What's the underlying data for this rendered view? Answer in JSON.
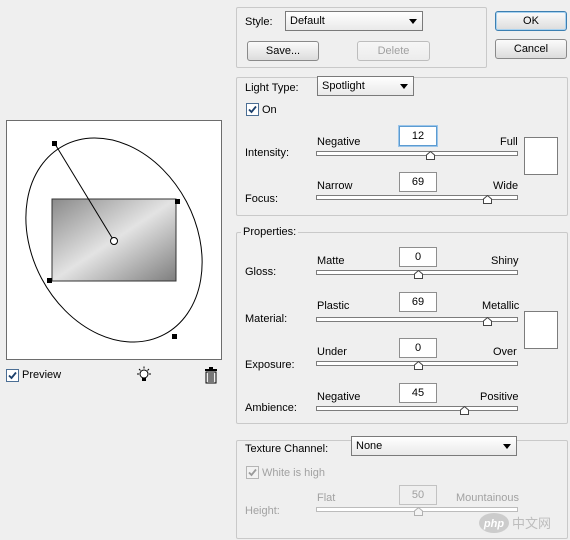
{
  "style": {
    "label": "Style:",
    "value": "Default",
    "save_label": "Save...",
    "delete_label": "Delete"
  },
  "dialog_buttons": {
    "ok_label": "OK",
    "cancel_label": "Cancel"
  },
  "light_type": {
    "label": "Light Type:",
    "value": "Spotlight",
    "on_label": "On",
    "on_checked": true,
    "intensity": {
      "label": "Intensity:",
      "left": "Negative",
      "right": "Full",
      "value": "12"
    },
    "focus": {
      "label": "Focus:",
      "left": "Narrow",
      "right": "Wide",
      "value": "69"
    }
  },
  "properties": {
    "title": "Properties:",
    "gloss": {
      "label": "Gloss:",
      "left": "Matte",
      "right": "Shiny",
      "value": "0"
    },
    "material": {
      "label": "Material:",
      "left": "Plastic",
      "right": "Metallic",
      "value": "69"
    },
    "exposure": {
      "label": "Exposure:",
      "left": "Under",
      "right": "Over",
      "value": "0"
    },
    "ambience": {
      "label": "Ambience:",
      "left": "Negative",
      "right": "Positive",
      "value": "45"
    }
  },
  "texture": {
    "label": "Texture Channel:",
    "value": "None",
    "white_is_high_label": "White is high",
    "white_is_high_checked": true,
    "height": {
      "label": "Height:",
      "left": "Flat",
      "right": "Mountainous",
      "value": "50"
    }
  },
  "preview": {
    "label": "Preview",
    "checked": true
  },
  "watermark": {
    "text": "php 中文网"
  },
  "colors": {
    "accent": "#3c7fb1",
    "panel": "#efefef",
    "border": "#c9c9c9"
  }
}
